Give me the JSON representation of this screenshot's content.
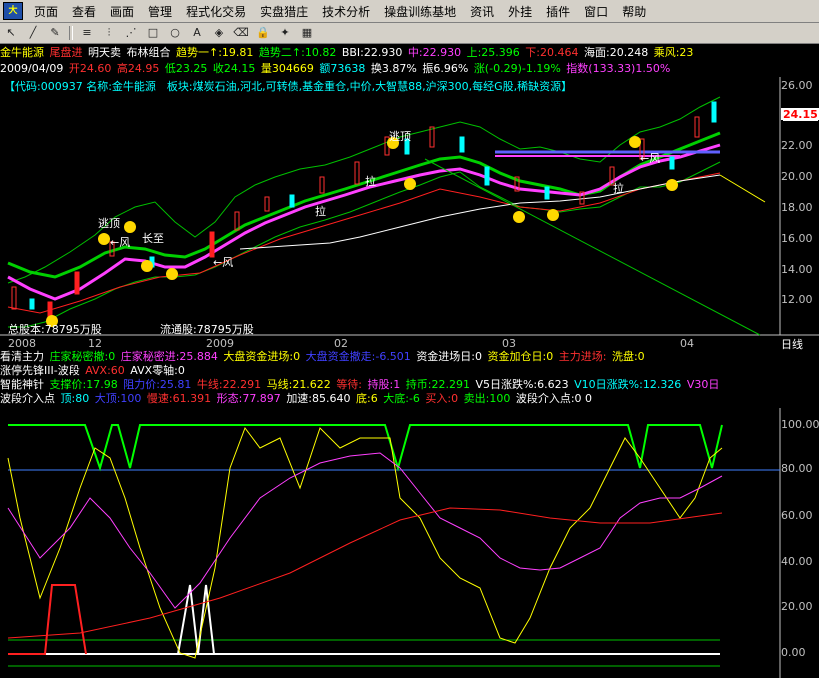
{
  "menu": [
    "页面",
    "查看",
    "画面",
    "管理",
    "程式化交易",
    "实盘猎庄",
    "技术分析",
    "操盘训练基地",
    "资讯",
    "外挂",
    "插件",
    "窗口",
    "帮助"
  ],
  "toolbar_icons": [
    "pointer-icon",
    "line-icon",
    "pen-icon",
    "hline-icon",
    "fan-icon",
    "channel-icon",
    "rect-icon",
    "ellipse-icon",
    "text-icon",
    "shapes-icon",
    "eraser-icon",
    "lock-icon",
    "mark-icon",
    "grid-icon"
  ],
  "header": {
    "name": "金牛能源",
    "flag": "尾盘进",
    "tip": "明天卖",
    "combo": "布林组合",
    "trend1": "趋势一↑:19.81",
    "trend2": "趋势二↑:10.82",
    "bbi": "BBI:22.930",
    "mid": "中:22.930",
    "upper": "上:25.396",
    "lower": "下:20.464",
    "sea": "海面:20.248",
    "wind": "乘风:23"
  },
  "ohlc": {
    "date": "2009/04/09",
    "open": "开24.60",
    "high": "高24.95",
    "low": "低23.25",
    "close": "收24.15",
    "vol": "量304669",
    "amount": "额73638",
    "turnover": "换3.87%",
    "amp": "振6.96%",
    "change": "涨(-0.29)-1.19%",
    "index": "指数(133.33)1.50%"
  },
  "profile": "【代码:000937 名称:金牛能源　板块:煤炭石油,河北,可转债,基金重仓,中价,大智慧88,沪深300,每经G股,稀缺资源】",
  "price_scale": [
    "26.00",
    "24.00",
    "22.00",
    "20.00",
    "18.00",
    "16.00",
    "14.00",
    "12.00"
  ],
  "last_price": "24.15",
  "chart_texts": {
    "top": "逃顶",
    "wind": "←风",
    "pull": "拉",
    "star": "长至"
  },
  "shares": {
    "total": "总股本:78795万股",
    "float": "流通股:78795万股"
  },
  "x_labels": [
    "2008",
    "12",
    "2009",
    "02",
    "03",
    "04"
  ],
  "period": "日线",
  "ind1": {
    "title": "看清主力",
    "a": "庄家秘密撤:0",
    "b": "庄家秘密进:25.884",
    "c": "大盘资金进场:0",
    "d": "大盘资金撤走:-6.501",
    "e": "资金进场日:0",
    "f": "资金加仓日:0",
    "g": "主力进场:",
    "h": "洗盘:0"
  },
  "ind2": {
    "title": "涨停先锋III-波段",
    "a": "AVX:60",
    "b": "AVX零轴:0"
  },
  "ind3": {
    "title": "智能神针",
    "a": "支撑价:17.98",
    "b": "阻力价:25.81",
    "c": "牛线:22.291",
    "d": "马线:21.622",
    "e": "等待:",
    "f": "持股:1",
    "g": "持币:22.291",
    "h": "V5日涨跌%:6.623",
    "i": "V10日涨跌%:12.326",
    "j": "V30日"
  },
  "ind4": {
    "title": "波段介入点",
    "a": "顶:80",
    "b": "大顶:100",
    "c": "慢速:61.391",
    "d": "形态:77.897",
    "e": "加速:85.640",
    "f": "底:6",
    "g": "大底:-6",
    "h": "买入:0",
    "i": "卖出:100",
    "j": "波段介入点:0 0"
  },
  "osc_scale": [
    "100.00",
    "80.00",
    "60.00",
    "40.00",
    "20.00",
    "0.00"
  ],
  "colors": {
    "up": "#ff3030",
    "down": "#00ffff",
    "ma_bold": "#ff40ff",
    "band": "#00c000",
    "bg": "#000000"
  }
}
